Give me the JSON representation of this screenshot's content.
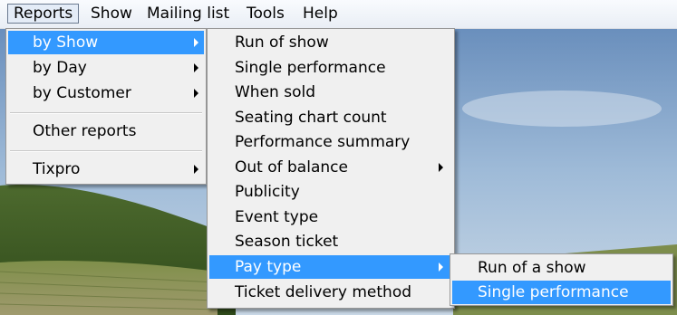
{
  "menubar": {
    "items": [
      {
        "label": "Reports",
        "open": true
      },
      {
        "label": "Show"
      },
      {
        "label": "Mailing list"
      },
      {
        "label": "Tools"
      },
      {
        "label": "Help"
      }
    ]
  },
  "reports_menu": {
    "items": [
      {
        "label": "by Show",
        "highlighted": true,
        "submenu": true
      },
      {
        "label": "by Day",
        "submenu": true
      },
      {
        "label": "by Customer",
        "submenu": true
      },
      {
        "label": "Other reports",
        "submenu": false
      },
      {
        "label": "Tixpro",
        "submenu": true
      }
    ]
  },
  "by_show_menu": {
    "items": [
      {
        "label": "Run of show"
      },
      {
        "label": "Single performance"
      },
      {
        "label": "When sold"
      },
      {
        "label": "Seating chart count"
      },
      {
        "label": "Performance summary"
      },
      {
        "label": "Out of balance",
        "submenu": true
      },
      {
        "label": "Publicity"
      },
      {
        "label": "Event type"
      },
      {
        "label": "Season ticket"
      },
      {
        "label": "Pay type",
        "highlighted": true,
        "submenu": true
      },
      {
        "label": "Ticket delivery method"
      }
    ]
  },
  "pay_type_menu": {
    "items": [
      {
        "label": "Run of a show"
      },
      {
        "label": "Single performance",
        "highlighted": true
      }
    ]
  },
  "colors": {
    "highlight": "#3399ff",
    "menu_bg": "#f0f0f0"
  }
}
